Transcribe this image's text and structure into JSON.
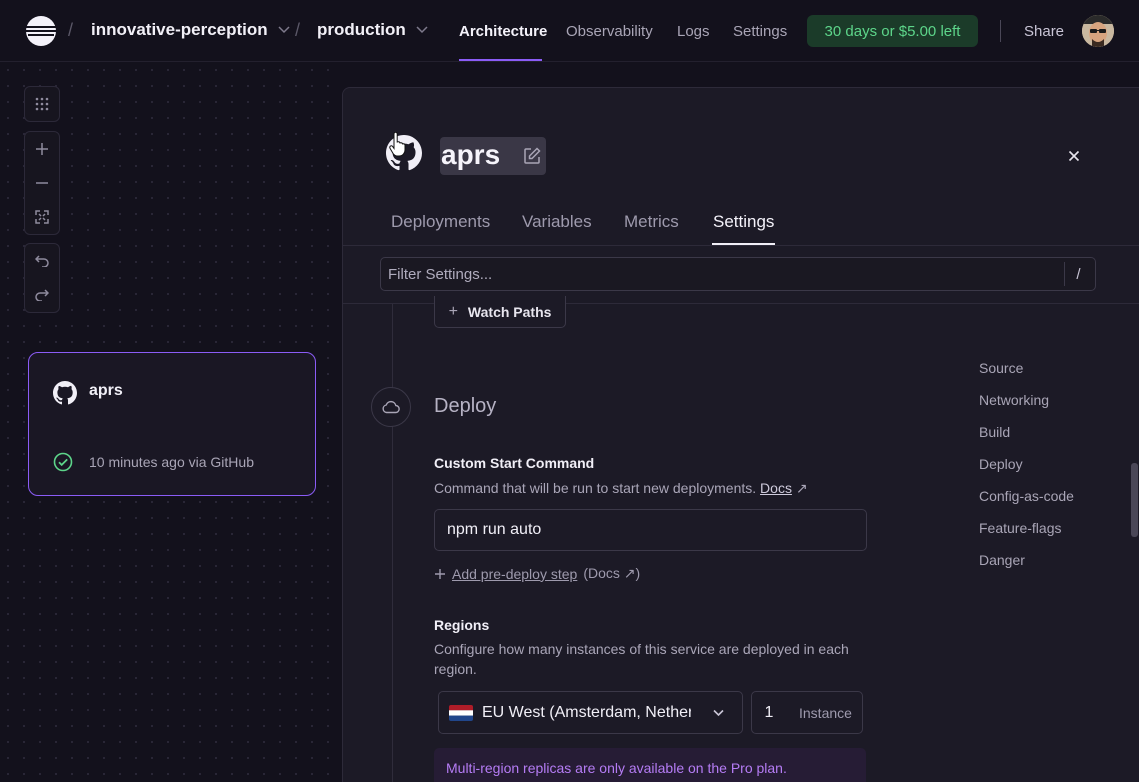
{
  "topbar": {
    "project": "innovative-perception",
    "environment": "production",
    "nav": [
      "Architecture",
      "Observability",
      "Logs",
      "Settings"
    ],
    "trial": "30 days or $5.00 left",
    "share": "Share"
  },
  "canvas": {
    "service_card": {
      "name": "aprs",
      "status": "10 minutes ago via GitHub"
    }
  },
  "panel": {
    "service_name": "aprs",
    "tabs": [
      "Deployments",
      "Variables",
      "Metrics",
      "Settings"
    ],
    "active_tab": "Settings",
    "filter": {
      "placeholder": "Filter Settings...",
      "shortcut": "/"
    },
    "watch_paths_label": "Watch Paths",
    "deploy": {
      "title": "Deploy",
      "custom_start": {
        "label": "Custom Start Command",
        "desc": "Command that will be run to start new deployments.",
        "docs": "Docs",
        "docs_arrow": "↗",
        "value": "npm run auto"
      },
      "pre_deploy": {
        "label": "Add pre-deploy step",
        "docs": "(Docs ↗)"
      },
      "regions": {
        "label": "Regions",
        "desc": "Configure how many instances of this service are deployed in each region.",
        "selected": "EU West (Amsterdam, Netherlands)",
        "instances": "1",
        "instance_label": "Instance",
        "pro_note": "Multi-region replicas are only available on the Pro plan."
      }
    },
    "toc": [
      "Source",
      "Networking",
      "Build",
      "Deploy",
      "Config-as-code",
      "Feature-flags",
      "Danger"
    ]
  },
  "colors": {
    "accent": "#8b5cf6",
    "trial_bg": "#1b3b29",
    "trial_text": "#5dd58a",
    "pro_note_text": "#b57cf5"
  }
}
